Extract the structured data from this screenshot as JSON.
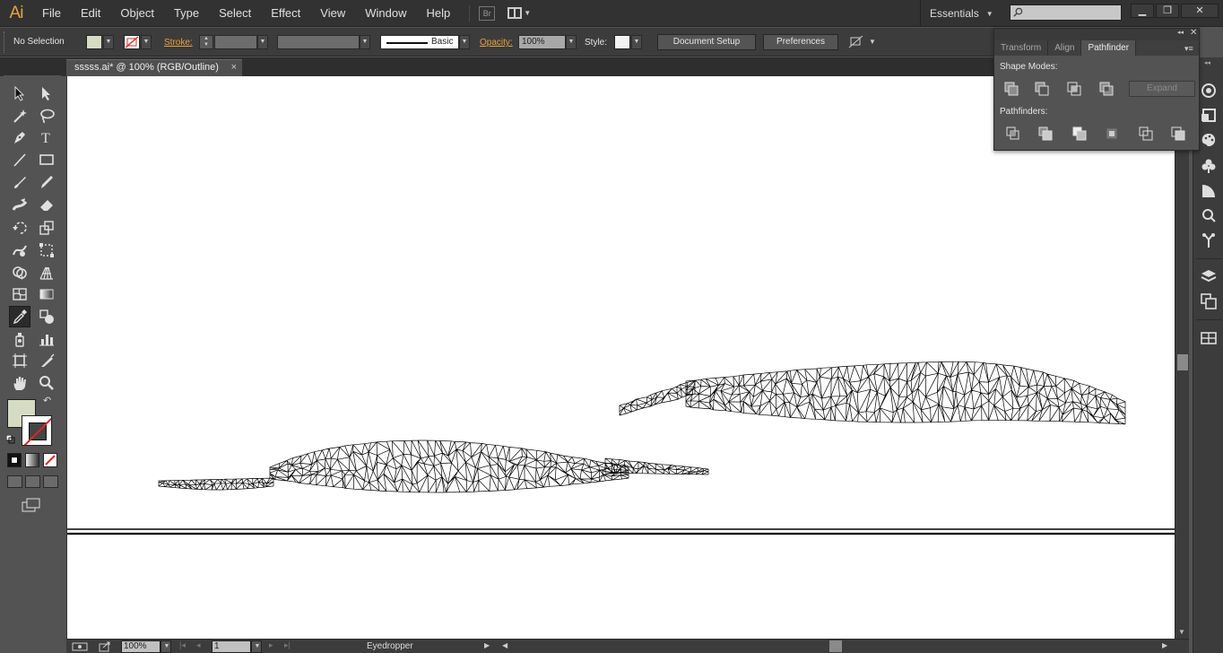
{
  "app": {
    "logo": "Ai"
  },
  "menu": [
    "File",
    "Edit",
    "Object",
    "Type",
    "Select",
    "Effect",
    "View",
    "Window",
    "Help"
  ],
  "bridge_label": "Br",
  "workspace": {
    "label": "Essentials"
  },
  "search": {
    "placeholder": ""
  },
  "control_bar": {
    "selection": "No Selection",
    "stroke_label": "Stroke:",
    "brush_label": "Basic",
    "opacity_label": "Opacity:",
    "opacity_value": "100%",
    "style_label": "Style:",
    "document_setup": "Document Setup",
    "preferences": "Preferences",
    "fill_color": "#d5dcc3"
  },
  "document": {
    "tab_title": "sssss.ai* @ 100% (RGB/Outline)",
    "close": "×"
  },
  "status": {
    "zoom": "100%",
    "page": "1",
    "tool": "Eyedropper"
  },
  "pathfinder_panel": {
    "tabs": [
      "Transform",
      "Align",
      "Pathfinder"
    ],
    "active_tab": "Pathfinder",
    "shape_modes_label": "Shape Modes:",
    "pathfinders_label": "Pathfinders:",
    "expand": "Expand"
  },
  "tools": [
    [
      "selection-tool-icon",
      "direct-selection-tool-icon"
    ],
    [
      "magic-wand-tool-icon",
      "lasso-tool-icon"
    ],
    [
      "pen-tool-icon",
      "type-tool-icon"
    ],
    [
      "line-segment-tool-icon",
      "rectangle-tool-icon"
    ],
    [
      "paintbrush-tool-icon",
      "pencil-tool-icon"
    ],
    [
      "blob-brush-tool-icon",
      "eraser-tool-icon"
    ],
    [
      "rotate-tool-icon",
      "scale-tool-icon"
    ],
    [
      "warp-tool-icon",
      "free-transform-tool-icon"
    ],
    [
      "shape-builder-tool-icon",
      "perspective-grid-tool-icon"
    ],
    [
      "mesh-tool-icon",
      "gradient-tool-icon"
    ],
    [
      "eyedropper-tool-icon",
      "blend-tool-icon"
    ],
    [
      "symbol-sprayer-tool-icon",
      "column-graph-tool-icon"
    ],
    [
      "artboard-tool-icon",
      "slice-tool-icon"
    ],
    [
      "hand-tool-icon",
      "zoom-tool-icon"
    ]
  ],
  "active_tool": "eyedropper-tool-icon"
}
